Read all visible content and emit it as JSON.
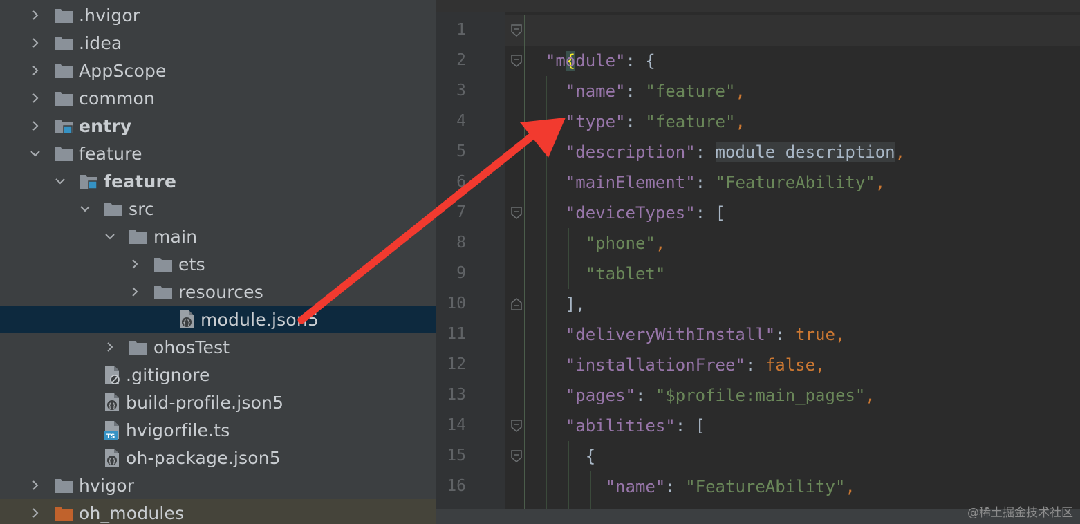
{
  "project_tree": {
    "items": [
      {
        "label": ".hvigor",
        "type": "folder",
        "expanded": false
      },
      {
        "label": ".idea",
        "type": "folder",
        "expanded": false
      },
      {
        "label": "AppScope",
        "type": "folder",
        "expanded": false
      },
      {
        "label": "common",
        "type": "folder",
        "expanded": false
      },
      {
        "label": "entry",
        "type": "module-folder",
        "expanded": false
      },
      {
        "label": "feature",
        "type": "folder",
        "expanded": true
      },
      {
        "label": "feature",
        "type": "module-folder",
        "expanded": true
      },
      {
        "label": "src",
        "type": "folder",
        "expanded": true
      },
      {
        "label": "main",
        "type": "folder",
        "expanded": true
      },
      {
        "label": "ets",
        "type": "folder",
        "expanded": false
      },
      {
        "label": "resources",
        "type": "folder",
        "expanded": false
      },
      {
        "label": "module.json5",
        "type": "json5-file",
        "selected": true
      },
      {
        "label": "ohosTest",
        "type": "folder",
        "expanded": false
      },
      {
        "label": ".gitignore",
        "type": "ignore-file"
      },
      {
        "label": "build-profile.json5",
        "type": "json5-file"
      },
      {
        "label": "hvigorfile.ts",
        "type": "ts-file"
      },
      {
        "label": "oh-package.json5",
        "type": "json5-file"
      },
      {
        "label": "hvigor",
        "type": "folder",
        "expanded": false
      },
      {
        "label": "oh_modules",
        "type": "excluded-folder",
        "expanded": false
      }
    ],
    "ts_badge": "TS"
  },
  "editor": {
    "line_numbers": [
      "1",
      "2",
      "3",
      "4",
      "5",
      "6",
      "7",
      "8",
      "9",
      "10",
      "11",
      "12",
      "13",
      "14",
      "15",
      "16"
    ],
    "code": {
      "l1_brace": "{",
      "l2_key": "\"module\"",
      "l2_rest": ": {",
      "l3_key": "\"name\"",
      "l3_val": "\"feature\"",
      "l4_key": "\"type\"",
      "l4_val": "\"feature\"",
      "l5_key": "\"description\"",
      "l5_val": "module description",
      "l6_key": "\"mainElement\"",
      "l6_val": "\"FeatureAbility\"",
      "l7_key": "\"deviceTypes\"",
      "l7_rest": ": [",
      "l8_val": "\"phone\"",
      "l9_val": "\"tablet\"",
      "l10_rest": "],",
      "l11_key": "\"deliveryWithInstall\"",
      "l11_val": "true",
      "l12_key": "\"installationFree\"",
      "l12_val": "false",
      "l13_key": "\"pages\"",
      "l13_val": "\"$profile:main_pages\"",
      "l14_key": "\"abilities\"",
      "l14_rest": ": [",
      "l15_rest": "{",
      "l16_key": "\"name\"",
      "l16_val": "\"FeatureAbility\"",
      "colon": ": ",
      "comma": ","
    }
  },
  "annotation": {
    "arrow_color": "#f23a2f"
  },
  "watermark": "@稀土掘金技术社区",
  "colors": {
    "tree_bg": "#3c3f41",
    "editor_bg": "#2b2b2b",
    "key": "#9876aa",
    "string": "#6a8759",
    "keyword": "#cc7832",
    "folder": "#8a9199",
    "module_badge": "#3592c4",
    "selection": "#0d293e"
  }
}
